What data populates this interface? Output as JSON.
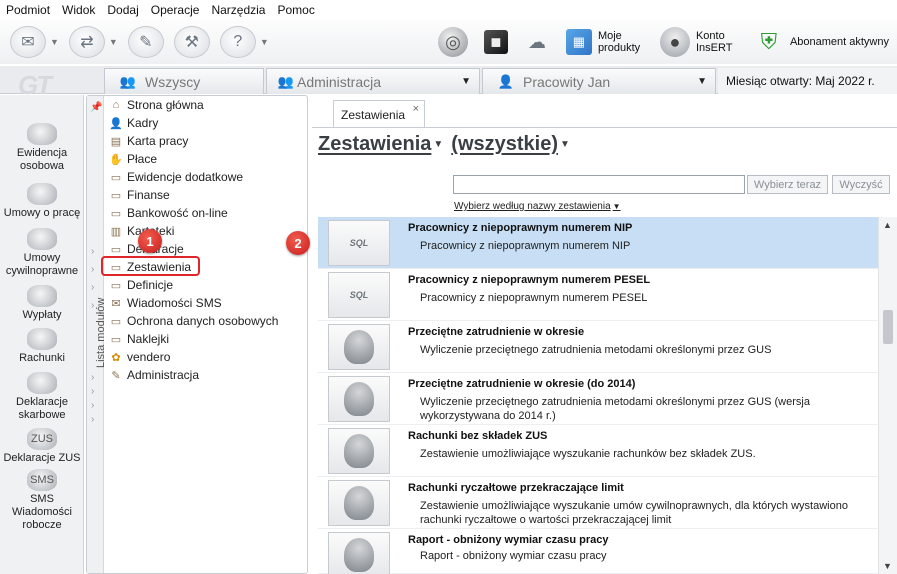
{
  "menu": [
    "Podmiot",
    "Widok",
    "Dodaj",
    "Operacje",
    "Narzędzia",
    "Pomoc"
  ],
  "toolbar": {
    "buttons": [
      {
        "name": "send-icon",
        "glyph": "✉",
        "dropdown": true
      },
      {
        "name": "receive-icon",
        "glyph": "⇄",
        "dropdown": true
      },
      {
        "name": "signature-icon",
        "glyph": "✎",
        "dropdown": false
      },
      {
        "name": "tools-icon",
        "glyph": "⚒",
        "dropdown": false
      },
      {
        "name": "help-icon",
        "glyph": "?",
        "dropdown": true
      }
    ],
    "my_products": "Moje produkty",
    "account": "Konto InsERT",
    "subscription": "Abonament aktywny"
  },
  "tabs": {
    "all": "Wszyscy",
    "admin": "Administracja",
    "employee": "Pracowity Jan",
    "month_label": "Miesiąc otwarty:",
    "month_value": "Maj 2022 r."
  },
  "sidebar": [
    {
      "label": "Ewidencja osobowa",
      "icon": "person-group-icon"
    },
    {
      "label": "Umowy o pracę",
      "icon": "contract-person-icon"
    },
    {
      "label": "Umowy cywilnoprawne",
      "icon": "civil-contract-icon"
    },
    {
      "label": "Wypłaty",
      "icon": "payout-icon"
    },
    {
      "label": "Rachunki",
      "icon": "bill-icon"
    },
    {
      "label": "Deklaracje skarbowe",
      "icon": "tax-declaration-icon"
    },
    {
      "label": "Deklaracje ZUS",
      "icon": "zus-icon",
      "glyph": "ZUS"
    },
    {
      "label": "SMS Wiadomości robocze",
      "icon": "sms-icon",
      "glyph": "SMS"
    }
  ],
  "modules": {
    "strip_label": "Lista modułów",
    "items": [
      {
        "label": "Strona główna",
        "icon": "home-icon",
        "glyph": "⌂"
      },
      {
        "label": "Kadry",
        "icon": "staff-icon",
        "glyph": "👤"
      },
      {
        "label": "Karta pracy",
        "icon": "work-card-icon",
        "glyph": "▤"
      },
      {
        "label": "Płace",
        "icon": "payroll-icon",
        "glyph": "✋"
      },
      {
        "label": "Ewidencje dodatkowe",
        "icon": "records-icon",
        "glyph": "▭"
      },
      {
        "label": "Finanse",
        "icon": "finance-icon",
        "glyph": "▭"
      },
      {
        "label": "Bankowość on-line",
        "icon": "bank-icon",
        "glyph": "▭"
      },
      {
        "label": "Kartoteki",
        "icon": "files-icon",
        "glyph": "▥"
      },
      {
        "label": "Deklaracje",
        "icon": "declarations-icon",
        "glyph": "▭"
      },
      {
        "label": "Zestawienia",
        "icon": "reports-icon",
        "glyph": "▭"
      },
      {
        "label": "Definicje",
        "icon": "definitions-icon",
        "glyph": "▭"
      },
      {
        "label": "Wiadomości SMS",
        "icon": "sms-icon",
        "glyph": "✉"
      },
      {
        "label": "Ochrona danych osobowych",
        "icon": "privacy-icon",
        "glyph": "▭"
      },
      {
        "label": "Naklejki",
        "icon": "sticker-icon",
        "glyph": "▭"
      },
      {
        "label": "vendero",
        "icon": "vendero-icon",
        "glyph": "✿"
      },
      {
        "label": "Administracja",
        "icon": "admin-icon",
        "glyph": "✎"
      }
    ]
  },
  "badges": {
    "one": "1",
    "two": "2"
  },
  "doc_tab": {
    "label": "Zestawienia",
    "close": "×"
  },
  "heading": {
    "title": "Zestawienia",
    "filter": "(wszystkie)"
  },
  "search": {
    "value": "",
    "choose_button": "Wybierz teraz",
    "clear_button": "Wyczyść",
    "by_name": "Wybierz według nazwy zestawienia"
  },
  "reports": [
    {
      "title": "Pracownicy z niepoprawnym numerem NIP",
      "desc": "Pracownicy z niepoprawnym numerem NIP",
      "type": "sql",
      "selected": true
    },
    {
      "title": "Pracownicy z niepoprawnym numerem PESEL",
      "desc": "Pracownicy z niepoprawnym numerem PESEL",
      "type": "sql",
      "selected": false
    },
    {
      "title": "Przeciętne zatrudnienie w okresie",
      "desc": "Wyliczenie przeciętnego zatrudnienia metodami określonymi przez GUS",
      "type": "person",
      "selected": false
    },
    {
      "title": "Przeciętne zatrudnienie w okresie (do 2014)",
      "desc": "Wyliczenie przeciętnego zatrudnienia metodami określonymi przez GUS (wersja wykorzystywana do 2014 r.)",
      "type": "person",
      "selected": false
    },
    {
      "title": "Rachunki bez składek ZUS",
      "desc": "Zestawienie umożliwiające wyszukanie rachunków bez składek ZUS.",
      "type": "person",
      "selected": false
    },
    {
      "title": "Rachunki ryczałtowe przekraczające limit",
      "desc": "Zestawienie umożliwiające wyszukanie umów cywilnoprawnych, dla których wystawiono rachunki ryczałtowe o wartości przekraczającej limit",
      "type": "person",
      "selected": false
    },
    {
      "title": "Raport - obniżony wymiar czasu pracy",
      "desc": "Raport - obniżony wymiar czasu pracy",
      "type": "person",
      "selected": false
    }
  ]
}
